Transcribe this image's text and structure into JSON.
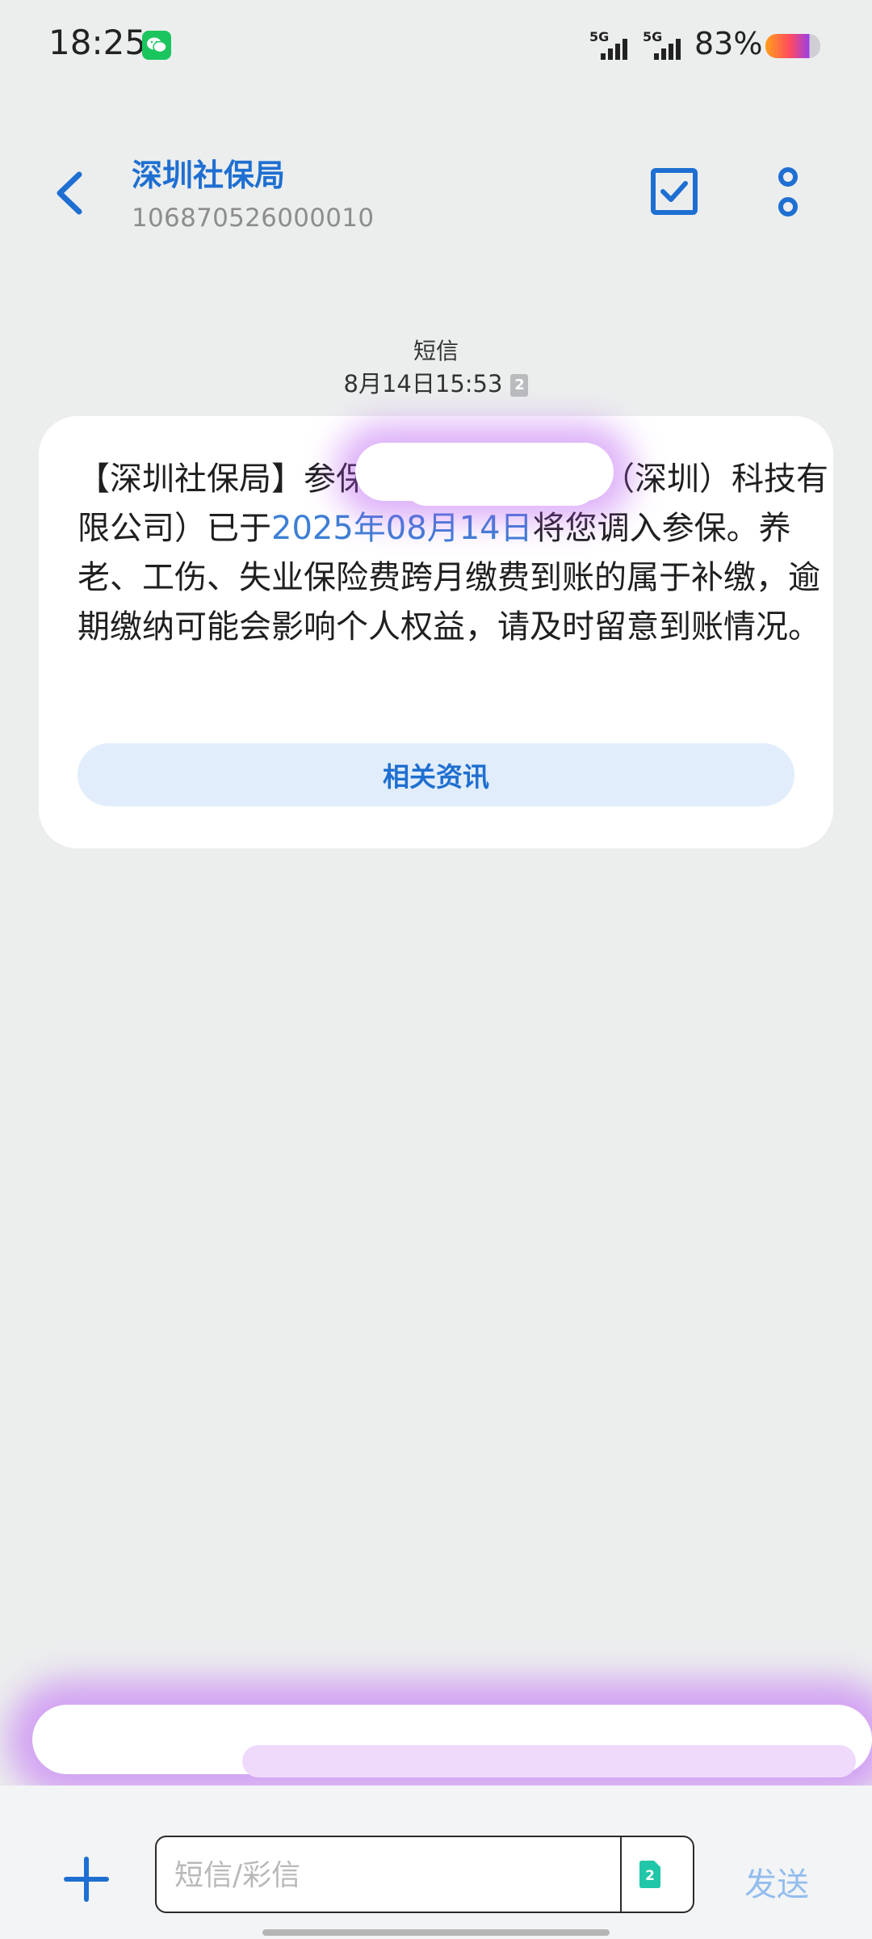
{
  "status_bar": {
    "time": "18:25",
    "sim1_label": "5G",
    "sim2_label": "5G",
    "battery": "83%",
    "battery_level": 0.83,
    "notification_icon": "wechat-icon"
  },
  "header": {
    "title": "深圳社保局",
    "subtitle": "106870526000010",
    "back_icon": "chevron-left-icon",
    "select_icon": "checkbox-icon",
    "more_icon": "more-vertical-icon"
  },
  "conversation": {
    "message_type": "短信",
    "timestamp": "8月14日15:53",
    "sim_badge": "2",
    "message": {
      "part1": "【深圳社保局】参保",
      "redacted_gap": "",
      "part2": "空（深圳）科技有限公司）已于",
      "date_link": "2025年08月14日",
      "part3": "将您调入参保。养老、工伤、失业保险费跨月缴费到账的属于补缴，逾期缴纳可能会影响个人权益，请及时留意到账情况。"
    },
    "related_button": "相关资讯"
  },
  "composer": {
    "placeholder": "短信/彩信",
    "sim_badge": "2",
    "send_label": "发送"
  },
  "colors": {
    "accent": "#1e6fd1",
    "link": "#3d7fd4",
    "background": "#eceeee",
    "bubble": "#ffffff",
    "related_bg": "#e1edfb",
    "send_disabled": "#93bdee"
  }
}
